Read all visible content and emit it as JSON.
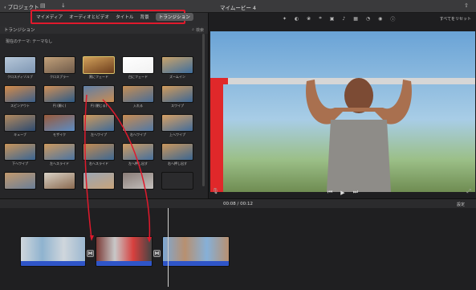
{
  "titlebar": {
    "back_label": "プロジェクト",
    "title": "マイムービー 4"
  },
  "tabs": [
    {
      "label": "マイメディア",
      "active": false
    },
    {
      "label": "オーディオとビデオ",
      "active": false
    },
    {
      "label": "タイトル",
      "active": false
    },
    {
      "label": "背景",
      "active": false
    },
    {
      "label": "トランジション",
      "active": true
    }
  ],
  "browser": {
    "header": "トランジション",
    "search_placeholder": "検索",
    "theme_label": "現在のテーマ: テーマなし",
    "transitions": [
      {
        "label": "クロスディゾルブ",
        "selected": false
      },
      {
        "label": "クロスブラー",
        "selected": false
      },
      {
        "label": "黒にフェード",
        "selected": true
      },
      {
        "label": "白にフェード",
        "selected": false
      },
      {
        "label": "ズームイン",
        "selected": false
      },
      {
        "label": "スピンアウト",
        "selected": false
      },
      {
        "label": "円 (開く)",
        "selected": false
      },
      {
        "label": "円 (閉じる)",
        "selected": false
      },
      {
        "label": "入れる",
        "selected": false
      },
      {
        "label": "スワイプ",
        "selected": false
      },
      {
        "label": "キューブ",
        "selected": false
      },
      {
        "label": "モザイク",
        "selected": false
      },
      {
        "label": "左へワイプ",
        "selected": false
      },
      {
        "label": "右へワイプ",
        "selected": false
      },
      {
        "label": "上へワイプ",
        "selected": false
      },
      {
        "label": "下へワイプ",
        "selected": false
      },
      {
        "label": "左へスライド",
        "selected": false
      },
      {
        "label": "右へスライド",
        "selected": false
      },
      {
        "label": "左へ押し出す",
        "selected": false
      },
      {
        "label": "右へ押し出す",
        "selected": false
      },
      {
        "label": "",
        "selected": false
      },
      {
        "label": "",
        "selected": false
      },
      {
        "label": "",
        "selected": false
      },
      {
        "label": "",
        "selected": false
      },
      {
        "label": "",
        "selected": false
      }
    ]
  },
  "viewer": {
    "reset_label": "すべてをリセット"
  },
  "timeline": {
    "current_time": "00:08",
    "total_time": "00:12",
    "settings_label": "設定"
  },
  "colors": {
    "highlight": "#e0192c",
    "audio_track": "#2f55c8"
  }
}
